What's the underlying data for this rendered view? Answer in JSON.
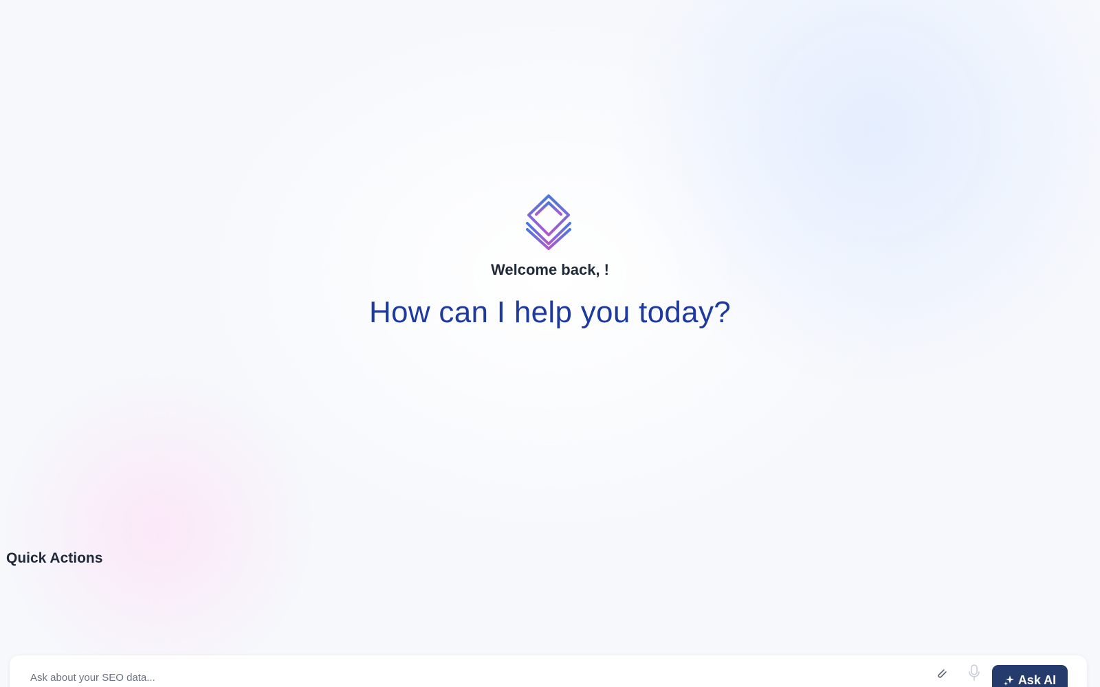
{
  "hero": {
    "logo_icon": "layered-diamond-logo",
    "welcome_text": "Welcome back, !",
    "headline": "How can I help you today?"
  },
  "quick_actions": {
    "title": "Quick Actions"
  },
  "composer": {
    "placeholder": "Ask about your SEO data...",
    "value": "",
    "attach_icon": "paperclip-icon",
    "mic_icon": "microphone-icon",
    "submit_label": "Ask AI",
    "submit_icon": "sparkles-icon"
  },
  "colors": {
    "headline": "#1e3a9f",
    "button_bg": "#243b6b",
    "logo_gradient_top": "#4a78e0",
    "logo_gradient_bottom": "#b05ac8"
  }
}
